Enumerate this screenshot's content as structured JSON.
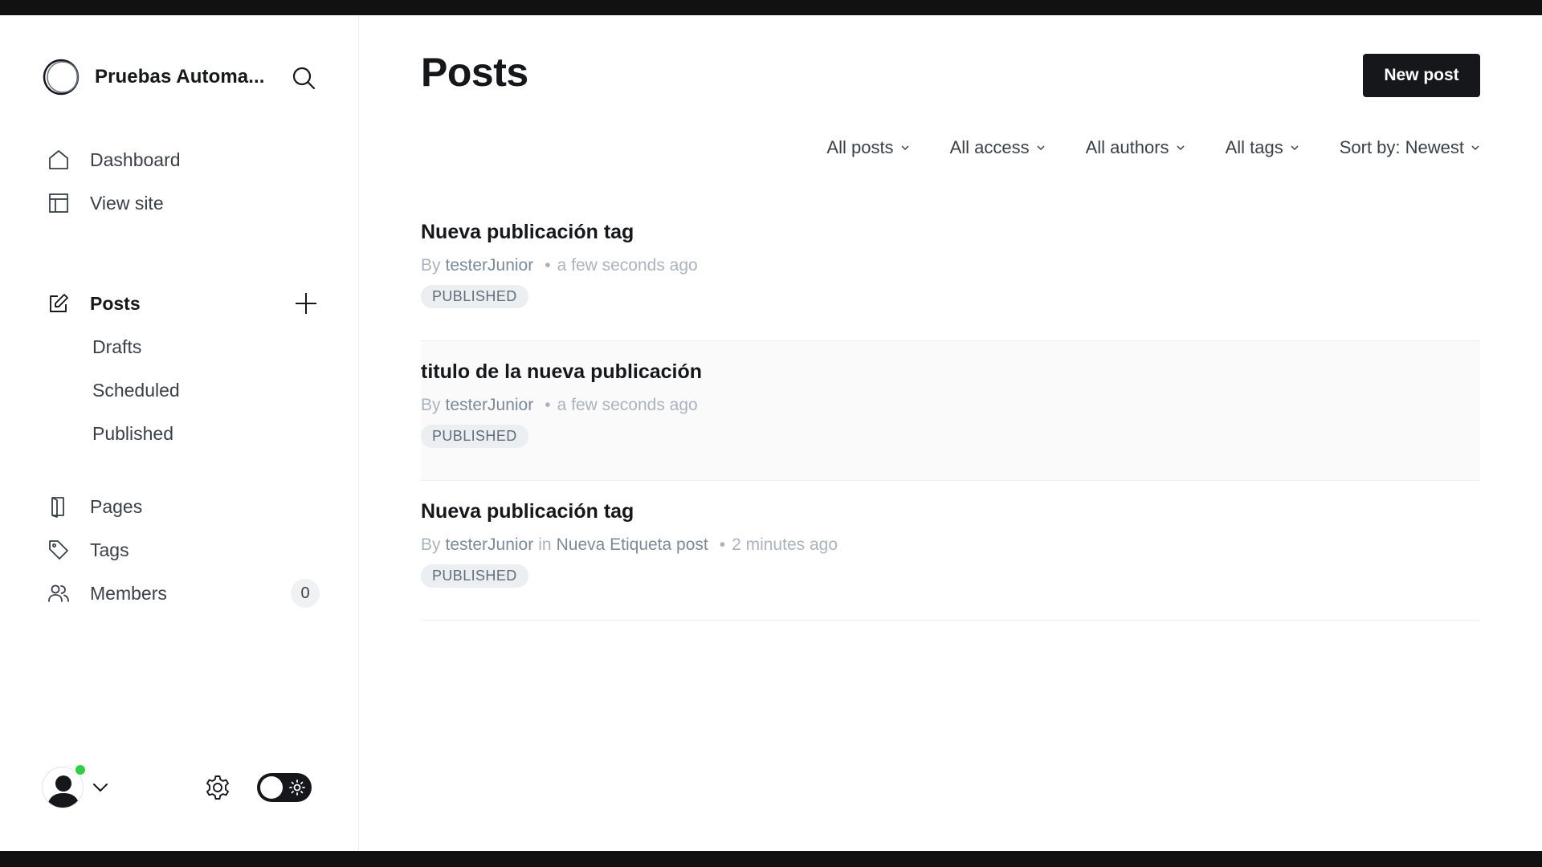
{
  "sidebar": {
    "brand": {
      "name": "Pruebas Automa..."
    },
    "nav": [
      {
        "label": "Dashboard",
        "icon": "home-icon"
      },
      {
        "label": "View site",
        "icon": "layout-icon"
      }
    ],
    "posts": {
      "label": "Posts",
      "icon": "edit-icon"
    },
    "post_sub": [
      "Drafts",
      "Scheduled",
      "Published"
    ],
    "nav2": [
      {
        "label": "Pages",
        "icon": "page-icon"
      },
      {
        "label": "Tags",
        "icon": "tag-icon"
      },
      {
        "label": "Members",
        "icon": "members-icon",
        "count": "0"
      }
    ]
  },
  "header": {
    "title": "Posts",
    "new_post_label": "New post"
  },
  "filters": [
    "All posts",
    "All access",
    "All authors",
    "All tags",
    "Sort by: Newest"
  ],
  "posts": [
    {
      "title": "Nueva publicación tag",
      "by": "By",
      "author": "testerJunior",
      "in": "",
      "tag": "",
      "time": "a few seconds ago",
      "status": "PUBLISHED"
    },
    {
      "title": "titulo de la nueva publicación",
      "by": "By",
      "author": "testerJunior",
      "in": "",
      "tag": "",
      "time": "a few seconds ago",
      "status": "PUBLISHED"
    },
    {
      "title": "Nueva publicación tag",
      "by": "By",
      "author": "testerJunior",
      "in": "in",
      "tag": "Nueva Etiqueta post",
      "time": "2 minutes ago",
      "status": "PUBLISHED"
    }
  ],
  "colors": {
    "accent_dark": "#15171a",
    "online": "#30cf43",
    "meta": "#abb4be"
  }
}
